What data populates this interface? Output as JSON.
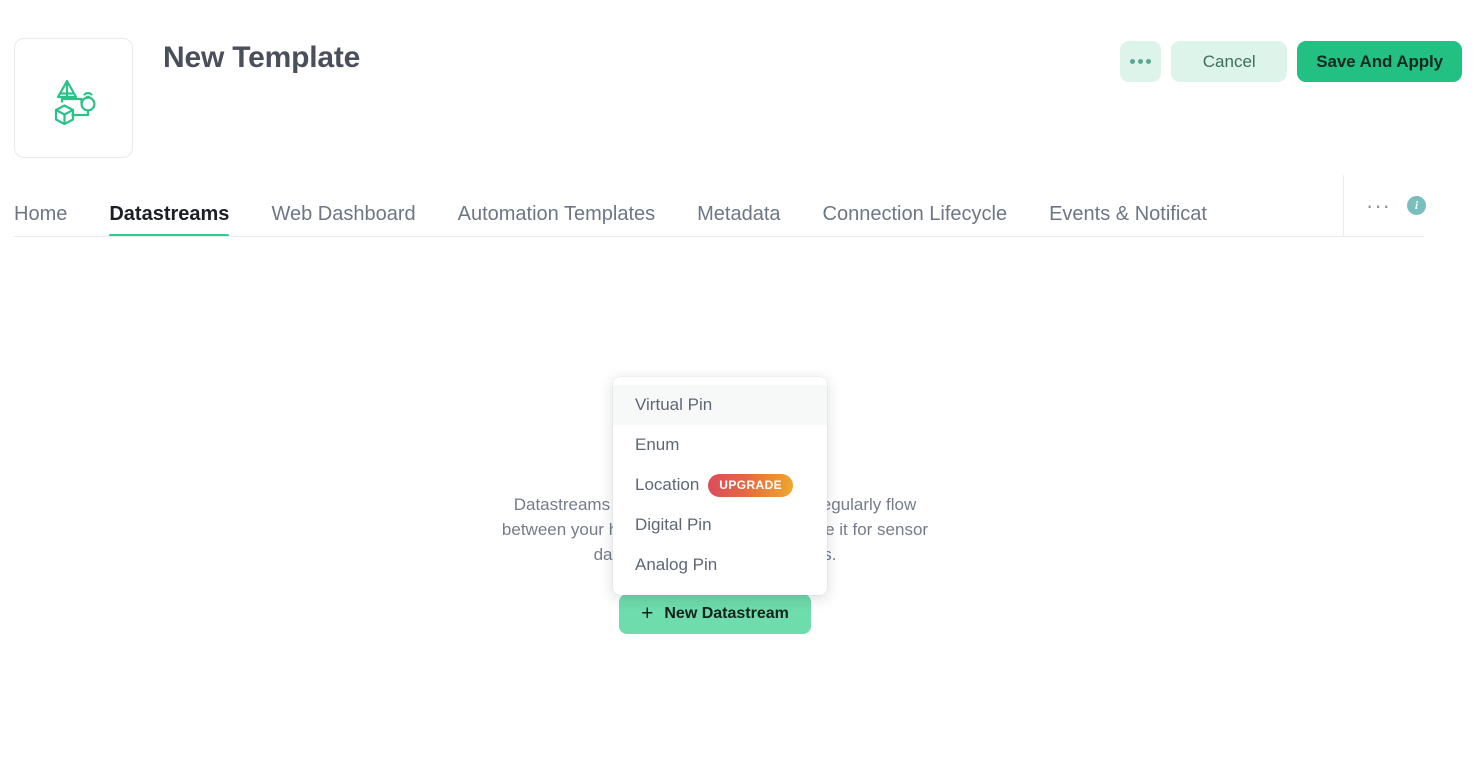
{
  "header": {
    "title": "New Template",
    "logo_icon": "iot-template-icon",
    "actions": {
      "more_label": "•••",
      "more_icon": "ellipsis-icon",
      "cancel_label": "Cancel",
      "save_label": "Save And Apply"
    }
  },
  "tabs": {
    "items": [
      {
        "label": "Home",
        "active": false
      },
      {
        "label": "Datastreams",
        "active": true
      },
      {
        "label": "Web Dashboard",
        "active": false
      },
      {
        "label": "Automation Templates",
        "active": false
      },
      {
        "label": "Metadata",
        "active": false
      },
      {
        "label": "Connection Lifecycle",
        "active": false
      },
      {
        "label": "Events & Notificat",
        "active": false
      }
    ],
    "overflow_label": "···",
    "info_label": "i"
  },
  "main": {
    "empty_state": {
      "description": "Datastreams are the pieces of data that regularly flow between your hardware and the device. Use it for sensor data, LED states, and actuators.",
      "new_button_label": "New Datastream",
      "new_button_icon": "plus-icon"
    }
  },
  "dropdown": {
    "items": [
      {
        "label": "Virtual Pin",
        "highlighted": true,
        "badge": null
      },
      {
        "label": "Enum",
        "highlighted": false,
        "badge": null
      },
      {
        "label": "Location",
        "highlighted": false,
        "badge": "UPGRADE"
      },
      {
        "label": "Digital Pin",
        "highlighted": false,
        "badge": null
      },
      {
        "label": "Analog Pin",
        "highlighted": false,
        "badge": null
      }
    ]
  },
  "colors": {
    "brand_green": "#22c083",
    "light_green": "#6edcac",
    "mint_bg": "#ddf4ea",
    "tab_underline": "#2fcb90",
    "upgrade_from": "#de4a5d",
    "upgrade_to": "#efa92d",
    "info_badge": "#79bdbd",
    "title_text": "#4a4f5c",
    "muted_text": "#6e7685"
  }
}
